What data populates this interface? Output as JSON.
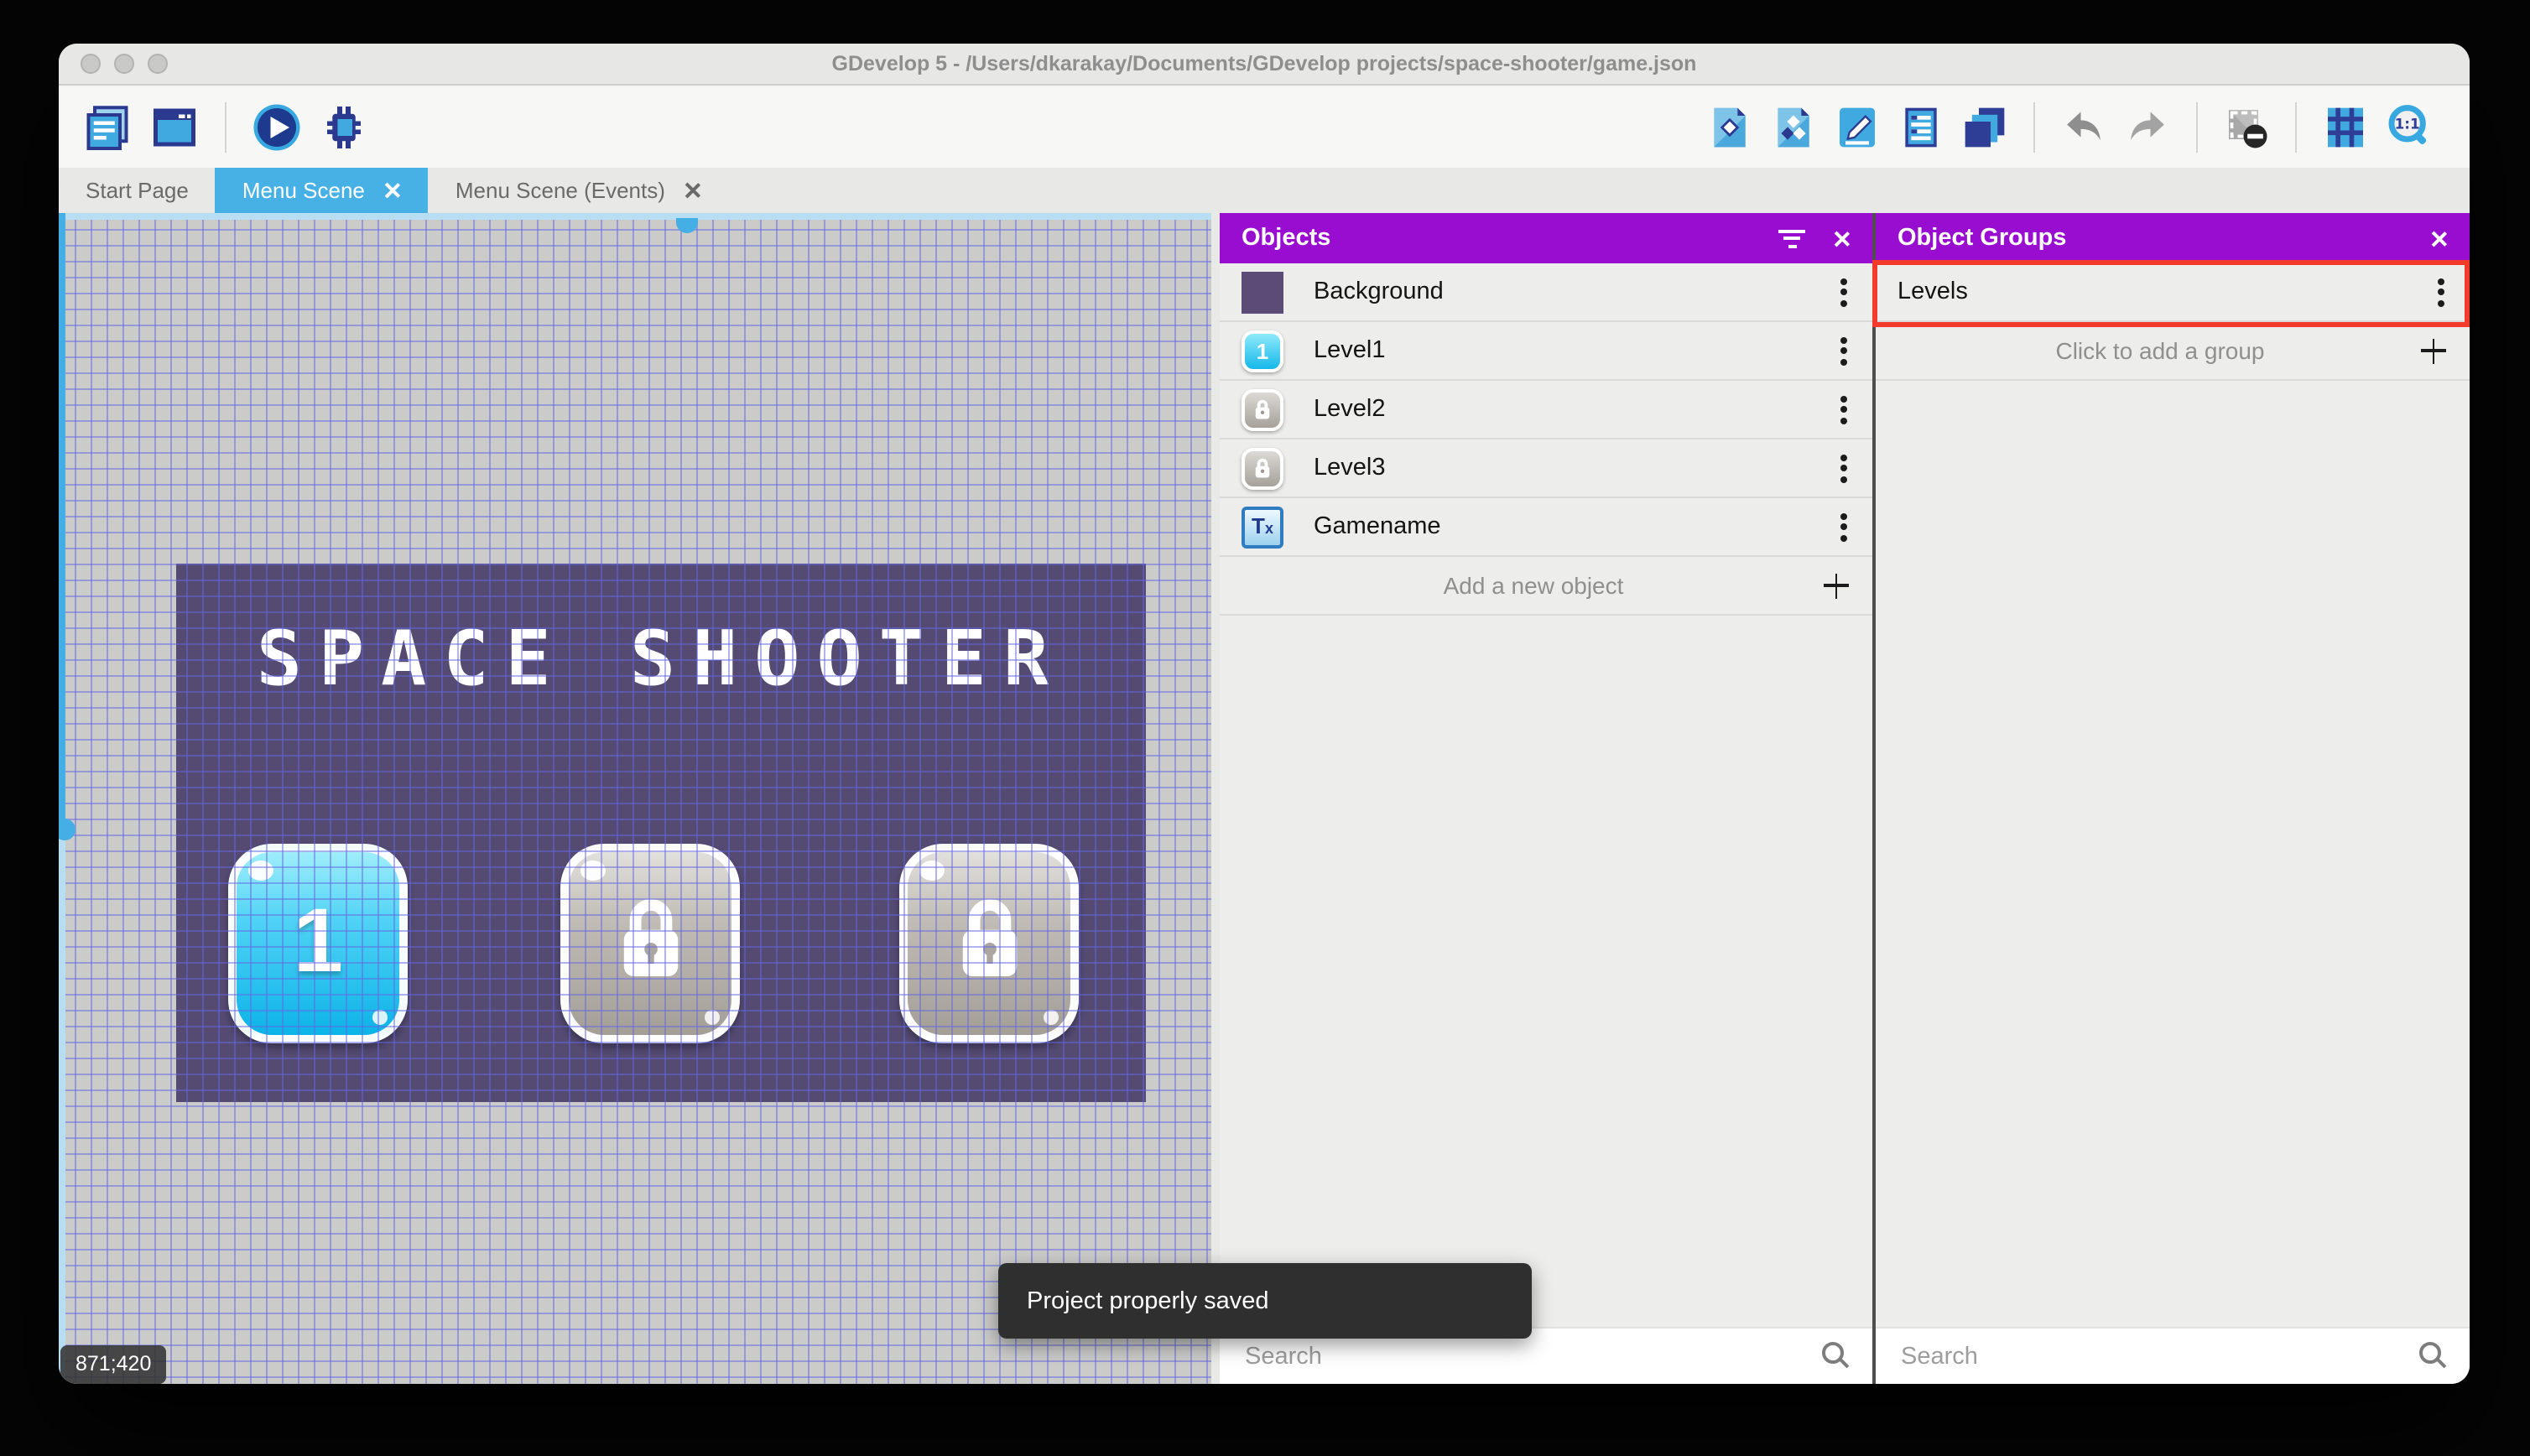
{
  "window": {
    "title": "GDevelop 5 - /Users/dkarakay/Documents/GDevelop projects/space-shooter/game.json"
  },
  "toolbar": {
    "left_icons": [
      "project-manager",
      "preview-window",
      "launch-preview",
      "launch-debugger"
    ],
    "right_icons": [
      "open-objects-editor",
      "open-object-groups-editor",
      "open-properties",
      "open-instances-list",
      "open-layers-editor",
      "undo",
      "redo",
      "toggle-window-mask",
      "toggle-grid",
      "zoom-original"
    ],
    "zoom_icon_label": "1:1"
  },
  "tabs": [
    {
      "label": "Start Page",
      "active": false,
      "closable": false
    },
    {
      "label": "Menu Scene",
      "active": true,
      "closable": true
    },
    {
      "label": "Menu Scene (Events)",
      "active": false,
      "closable": true
    }
  ],
  "canvas": {
    "coordinates": "871;420",
    "scene": {
      "title": "SPACE SHOOTER",
      "buttons": [
        {
          "label": "1",
          "state": "unlocked"
        },
        {
          "label": "",
          "state": "locked"
        },
        {
          "label": "",
          "state": "locked"
        }
      ]
    }
  },
  "objects_panel": {
    "title": "Objects",
    "items": [
      {
        "name": "Background",
        "icon": "purple-square"
      },
      {
        "name": "Level1",
        "icon": "blue-button-1"
      },
      {
        "name": "Level2",
        "icon": "locked-button"
      },
      {
        "name": "Level3",
        "icon": "locked-button"
      },
      {
        "name": "Gamename",
        "icon": "text-object"
      }
    ],
    "add_label": "Add a new object",
    "search_placeholder": "Search"
  },
  "object_groups_panel": {
    "title": "Object Groups",
    "groups": [
      {
        "name": "Levels",
        "highlighted": true
      }
    ],
    "add_label": "Click to add a group",
    "search_placeholder": "Search"
  },
  "toast": {
    "message": "Project properly saved"
  },
  "colors": {
    "accent_blue": "#47b1e6",
    "panel_header_purple": "#990dd0",
    "highlight_red": "#f33b2b",
    "scene_purple": "#544a72"
  }
}
